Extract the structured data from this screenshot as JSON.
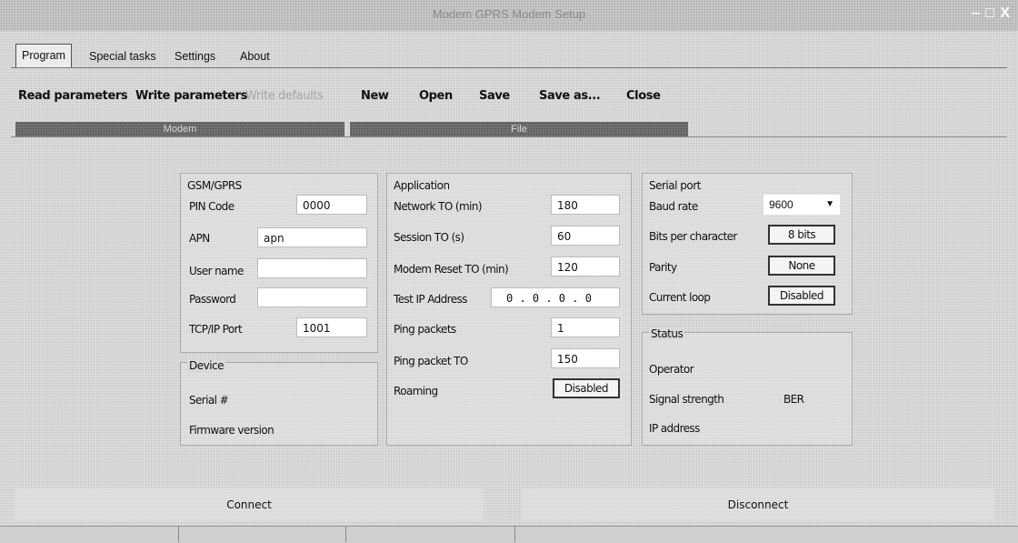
{
  "window": {
    "title": "Modem GPRS Modem Setup",
    "controls": "‒ □ X"
  },
  "tabs": [
    {
      "label": "Program",
      "active": true
    },
    {
      "label": "Special tasks"
    },
    {
      "label": "Settings"
    },
    {
      "label": "About"
    }
  ],
  "ribbon": {
    "modem": {
      "group_label": "Modem",
      "read": "Read parameters",
      "write": "Write parameters",
      "write_defaults": "Write defaults"
    },
    "file": {
      "group_label": "File",
      "new": "New",
      "open": "Open",
      "save": "Save",
      "save_as": "Save as...",
      "close": "Close"
    }
  },
  "gsm": {
    "title": "GSM/GPRS",
    "pin_label": "PIN Code",
    "pin_value": "0000",
    "apn_label": "APN",
    "apn_value": "apn",
    "user_label": "User name",
    "user_value": "",
    "password_label": "Password",
    "password_value": "",
    "port_label": "TCP/IP Port",
    "port_value": "1001"
  },
  "device": {
    "title": "Device",
    "serial_label": "Serial #",
    "firmware_label": "Firmware version"
  },
  "application": {
    "title": "Application",
    "network_to_label": "Network TO (min)",
    "network_to_value": "180",
    "session_to_label": "Session TO (s)",
    "session_to_value": "60",
    "modem_reset_label": "Modem Reset TO (min)",
    "modem_reset_value": "120",
    "test_ip_label": "Test IP Address",
    "test_ip_value": "0 .  0 .  0 .  0",
    "ping_packets_label": "Ping packets",
    "ping_packets_value": "1",
    "ping_to_label": "Ping packet TO",
    "ping_to_value": "150",
    "roaming_label": "Roaming",
    "roaming_value": "Disabled"
  },
  "serial": {
    "title": "Serial port",
    "baud_label": "Baud rate",
    "baud_value": "9600",
    "bits_label": "Bits per character",
    "bits_value": "8 bits",
    "parity_label": "Parity",
    "parity_value": "None",
    "loop_label": "Current loop",
    "loop_value": "Disabled"
  },
  "status": {
    "title": "Status",
    "operator_label": "Operator",
    "signal_label": "Signal strength",
    "ber_label": "BER",
    "ip_label": "IP address"
  },
  "footer": {
    "connect": "Connect",
    "disconnect": "Disconnect"
  }
}
